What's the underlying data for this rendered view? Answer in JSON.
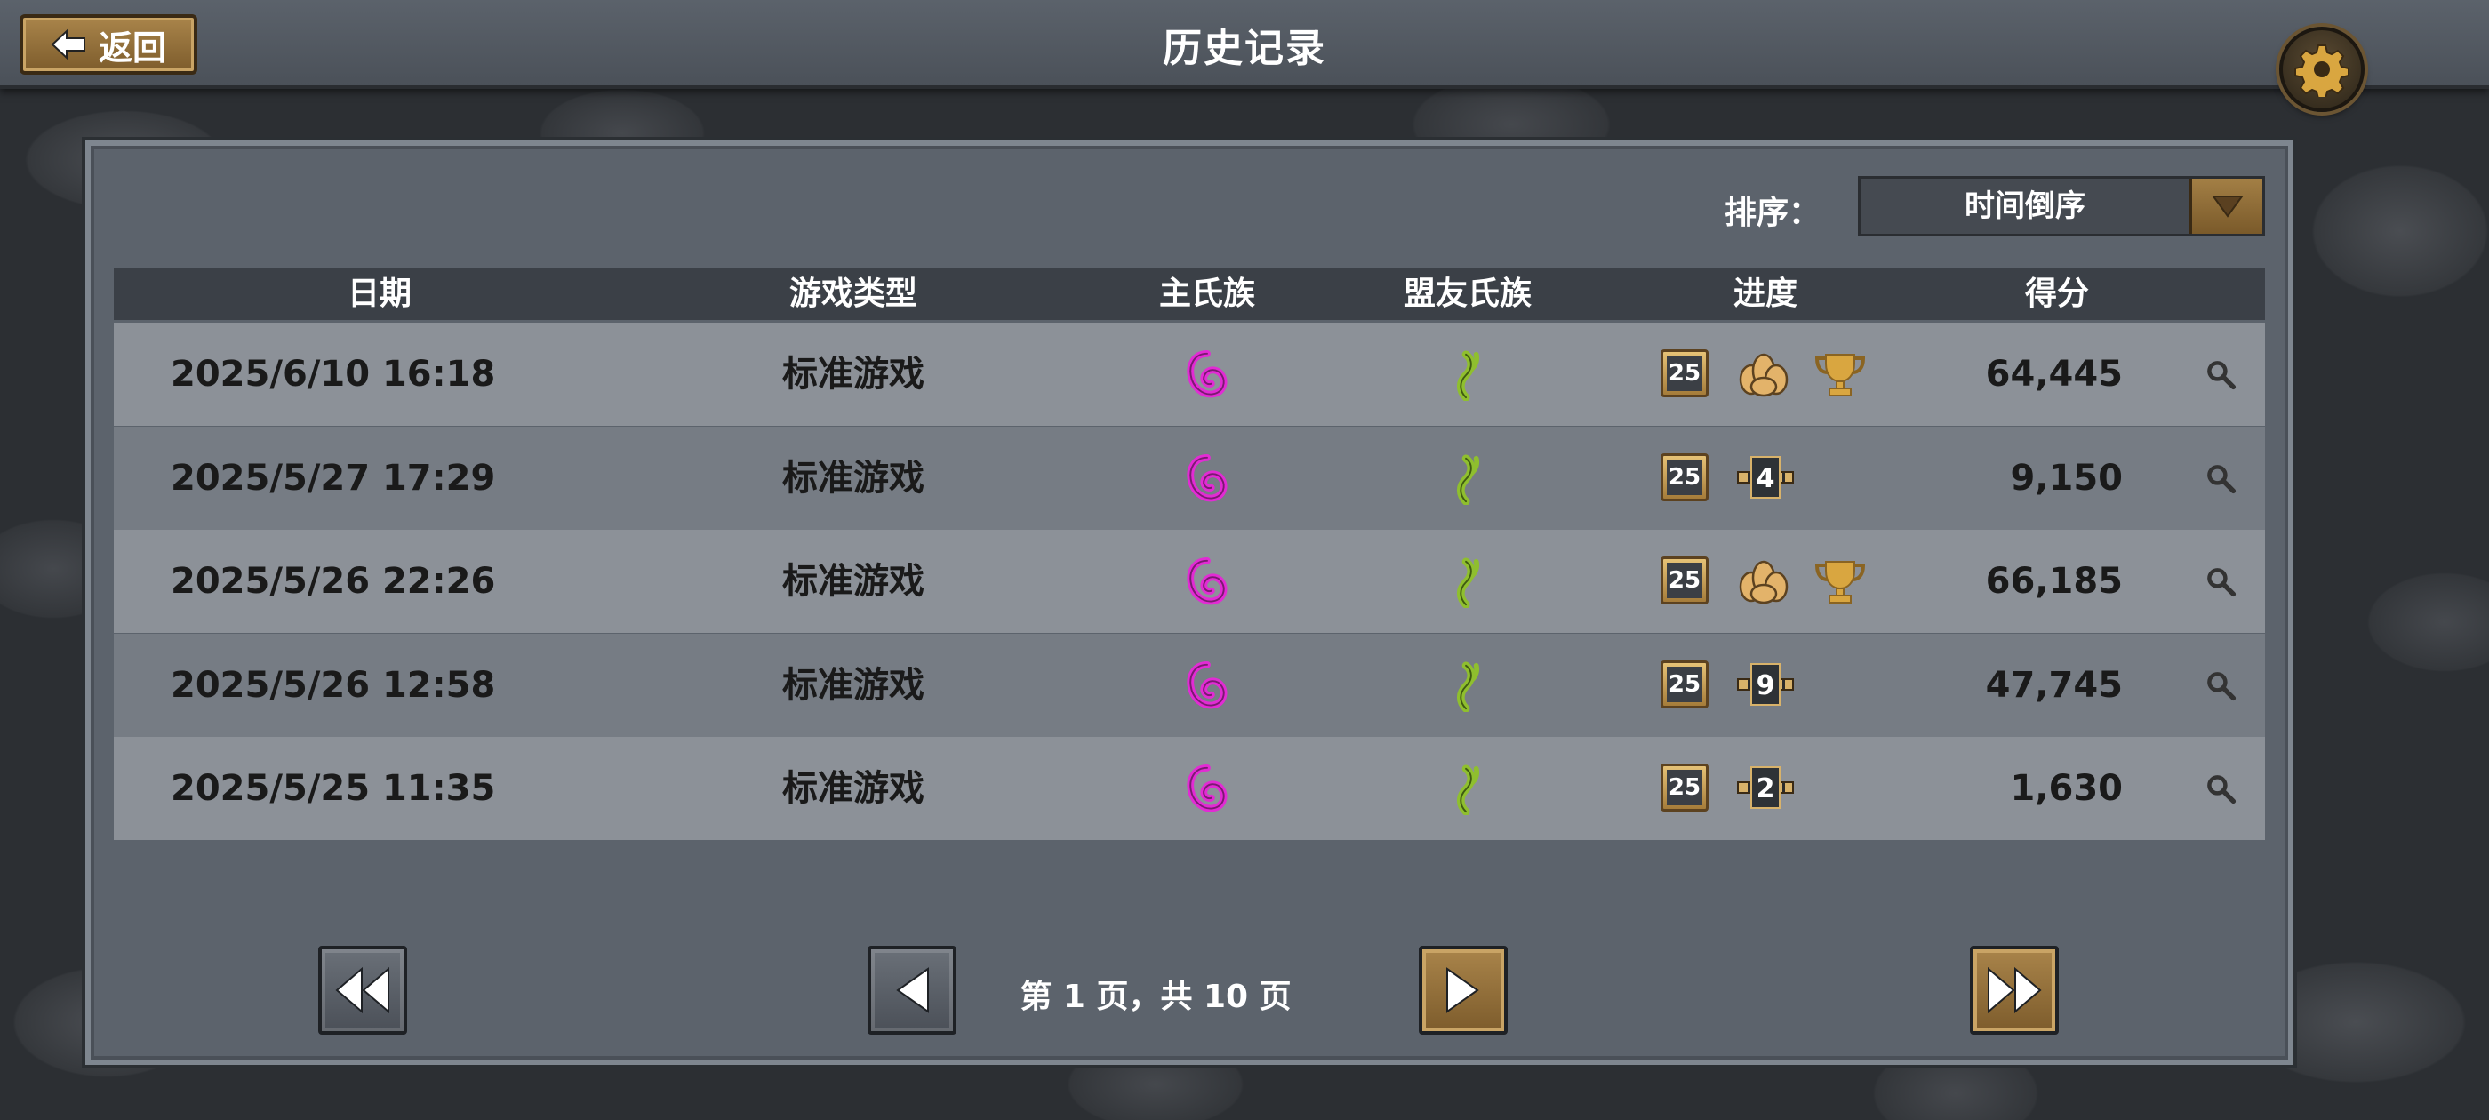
{
  "header": {
    "back_label": "返回",
    "title": "历史记录"
  },
  "sort": {
    "label": "排序：",
    "value": "时间倒序"
  },
  "table": {
    "columns": [
      "日期",
      "游戏类型",
      "主氏族",
      "盟友氏族",
      "进度",
      "得分"
    ],
    "rows": [
      {
        "date": "2025/6/10 16:18",
        "type": "标准游戏",
        "level": "25",
        "result": "victory",
        "score": "64,445"
      },
      {
        "date": "2025/5/27 17:29",
        "type": "标准游戏",
        "level": "25",
        "result": "defeat",
        "rank": "4",
        "score": "9,150"
      },
      {
        "date": "2025/5/26 22:26",
        "type": "标准游戏",
        "level": "25",
        "result": "victory",
        "score": "66,185"
      },
      {
        "date": "2025/5/26 12:58",
        "type": "标准游戏",
        "level": "25",
        "result": "defeat",
        "rank": "9",
        "score": "47,745"
      },
      {
        "date": "2025/5/25 11:35",
        "type": "标准游戏",
        "level": "25",
        "result": "defeat",
        "rank": "2",
        "score": "1,630"
      }
    ]
  },
  "pagination": {
    "info": "第 1 页，共 10 页"
  },
  "colors": {
    "main_clan": "#e22bd4",
    "ally_clan": "#8fbf2e",
    "gold": "#d9a640"
  }
}
